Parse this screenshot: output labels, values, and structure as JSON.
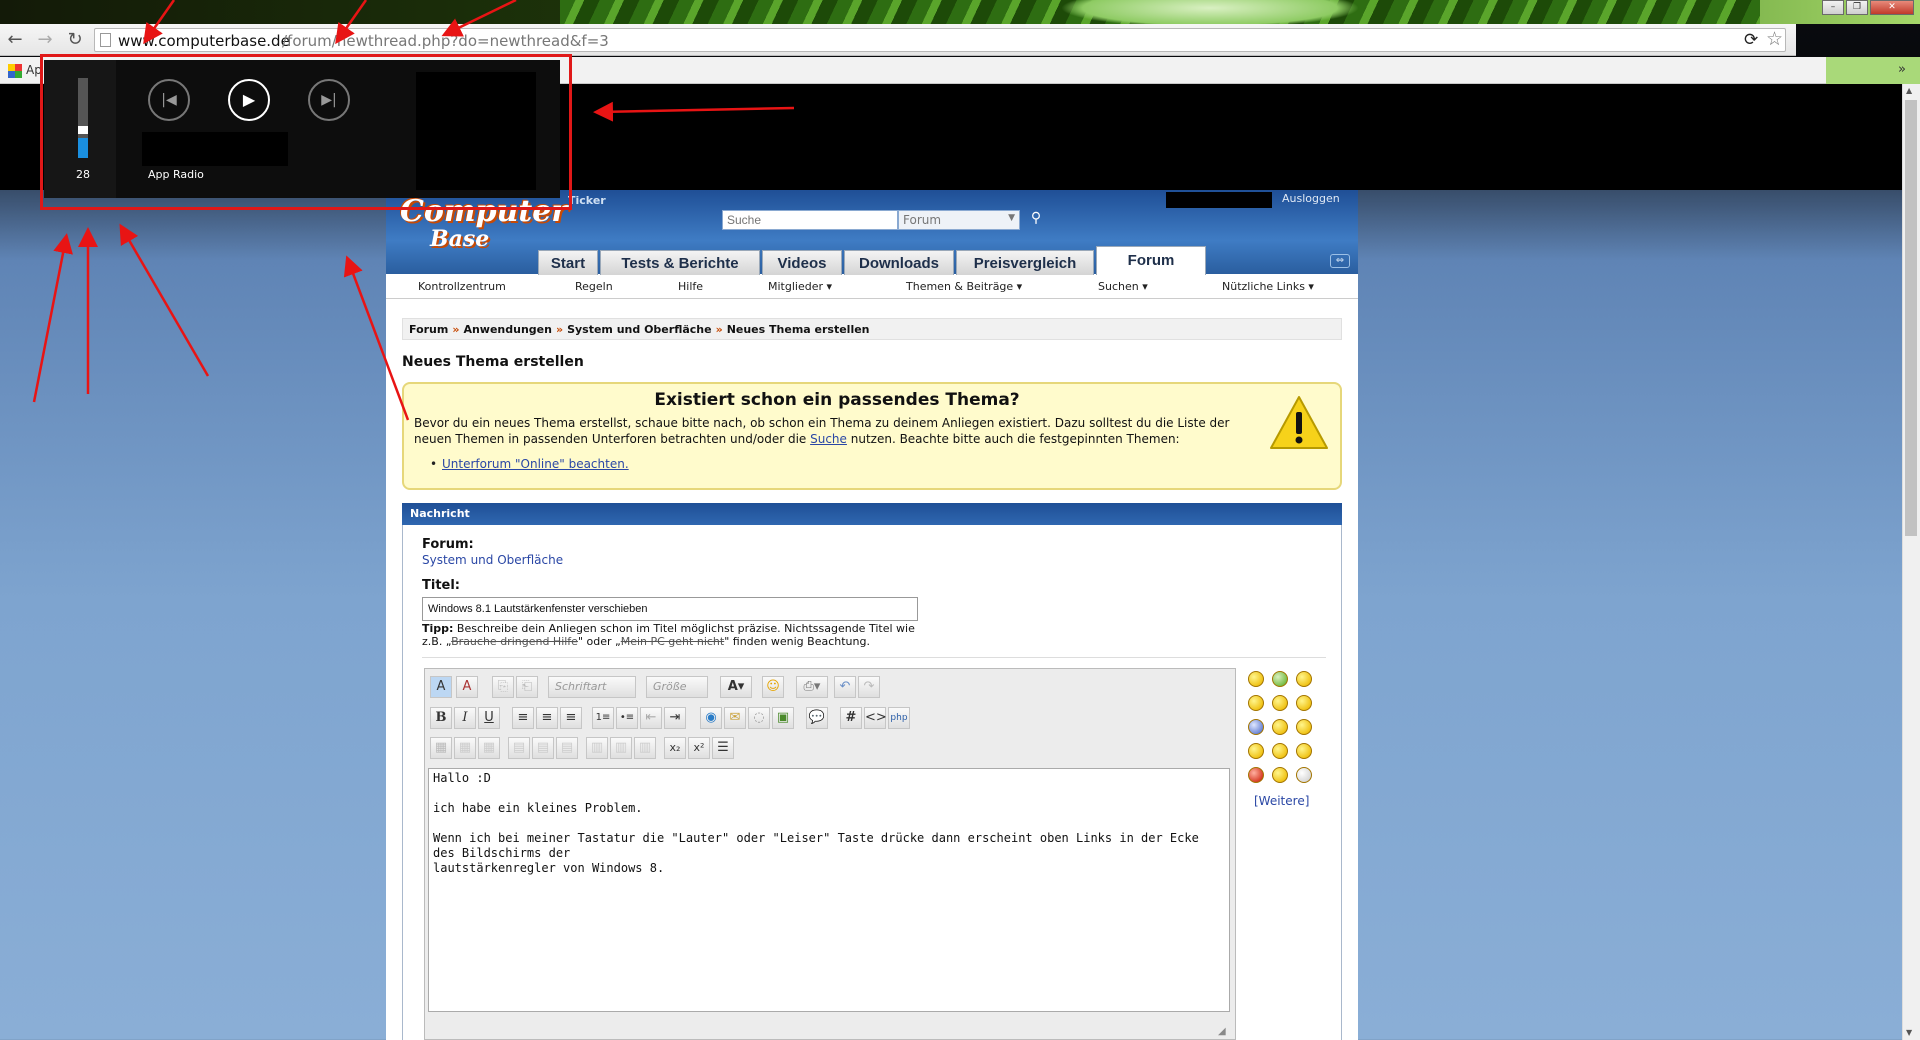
{
  "browser": {
    "url_host": "www.computerbase.de",
    "url_path": "/forum/newthread.php?do=newthread&f=3",
    "bookmarks_label": "Ap",
    "bookmarks_overflow": "»"
  },
  "volume_overlay": {
    "level": "28",
    "level_fraction": 0.28,
    "app_name": "App Radio",
    "accent_color": "#1a8fe0"
  },
  "site": {
    "logo_top": "Computer",
    "logo_bottom": "Base",
    "ticker_label": "Ticker",
    "search_placeholder": "Suche",
    "search_scope": "Forum",
    "logout_label": "Ausloggen",
    "tabs": [
      {
        "label": "Start"
      },
      {
        "label": "Tests & Berichte"
      },
      {
        "label": "Videos"
      },
      {
        "label": "Downloads"
      },
      {
        "label": "Preisvergleich"
      },
      {
        "label": "Forum"
      }
    ],
    "subnav": [
      {
        "label": "Kontrollzentrum"
      },
      {
        "label": "Regeln"
      },
      {
        "label": "Hilfe"
      },
      {
        "label": "Mitglieder ▾"
      },
      {
        "label": "Themen & Beiträge ▾"
      },
      {
        "label": "Suchen ▾"
      },
      {
        "label": "Nützliche Links ▾"
      }
    ],
    "breadcrumb": [
      "Forum",
      "Anwendungen",
      "System und Oberfläche",
      "Neues Thema erstellen"
    ],
    "breadcrumb_sep": "»",
    "page_title": "Neues Thema erstellen",
    "notice": {
      "title": "Existiert schon ein passendes Thema?",
      "text_before_link": "Bevor du ein neues Thema erstellst, schaue bitte nach, ob schon ein Thema zu deinem Anliegen existiert. Dazu solltest du die Liste der neuen Themen in passenden Unterforen betrachten und/oder die ",
      "link": "Suche",
      "text_after_link": " nutzen. Beachte bitte auch die festgepinnten Themen:",
      "bullet_link": "Unterforum \"Online\" beachten."
    },
    "message": {
      "header": "Nachricht",
      "forum_label": "Forum:",
      "forum_value": "System und Oberfläche",
      "title_label": "Titel:",
      "title_value": "Windows 8.1 Lautstärkenfenster verschieben",
      "tip_bold": "Tipp:",
      "tip_text1": " Beschreibe dein Anliegen schon im Titel möglichst präzise. Nichtssagende Titel wie z.B. „",
      "tip_strike1": "Brauche dringend Hilfe",
      "tip_text2": "\" oder „",
      "tip_strike2": "Mein PC geht nicht",
      "tip_text3": "\" finden wenig Beachtung.",
      "font_select": "Schriftart",
      "size_select": "Größe",
      "body_lines": [
        "Hallo :D",
        "",
        "ich habe ein kleines Problem.",
        "",
        "Wenn ich bei meiner Tastatur die \"Lauter\" oder \"Leiser\" Taste drücke dann erscheint oben Links in der Ecke des Bildschirms der",
        "lautstärkenregler von Windows 8."
      ],
      "more_smilies": "[Weitere]"
    }
  }
}
